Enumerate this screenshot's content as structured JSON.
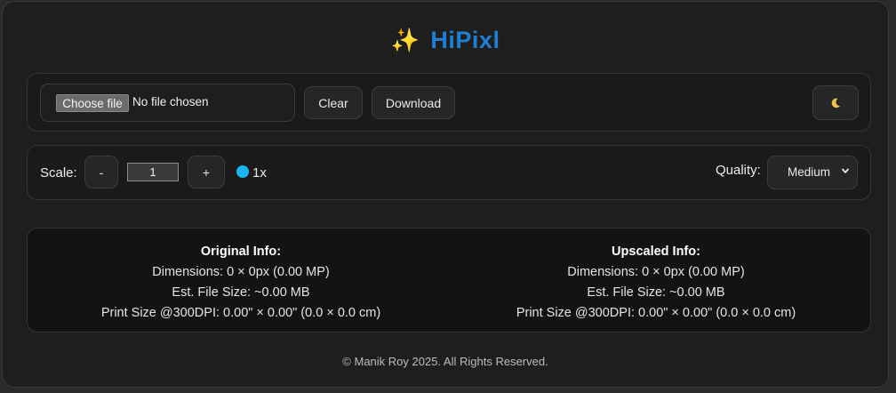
{
  "header": {
    "icon": "sparkles-icon",
    "title": "HiPixl",
    "accent_color": "#1f7fd1"
  },
  "toolbar": {
    "choose_file_label": "Choose file",
    "file_status": "No file chosen",
    "clear_label": "Clear",
    "download_label": "Download",
    "theme_icon": "moon-icon"
  },
  "controls": {
    "scale_label": "Scale:",
    "decrement_label": "-",
    "scale_value": "1",
    "increment_label": "+",
    "scale_indicator": "1x",
    "indicator_color": "#17b7ee",
    "quality_label": "Quality:",
    "quality_value": "Medium"
  },
  "original_info": {
    "heading": "Original Info:",
    "dimensions": "Dimensions: 0 × 0px (0.00 MP)",
    "file_size": "Est. File Size: ~0.00 MB",
    "print_size": "Print Size @300DPI: 0.00\" × 0.00\" (0.0 × 0.0 cm)"
  },
  "upscaled_info": {
    "heading": "Upscaled Info:",
    "dimensions": "Dimensions: 0 × 0px (0.00 MP)",
    "file_size": "Est. File Size: ~0.00 MB",
    "print_size": "Print Size @300DPI: 0.00\" × 0.00\" (0.0 × 0.0 cm)"
  },
  "footer": {
    "copyright": "© Manik Roy 2025. All Rights Reserved."
  }
}
